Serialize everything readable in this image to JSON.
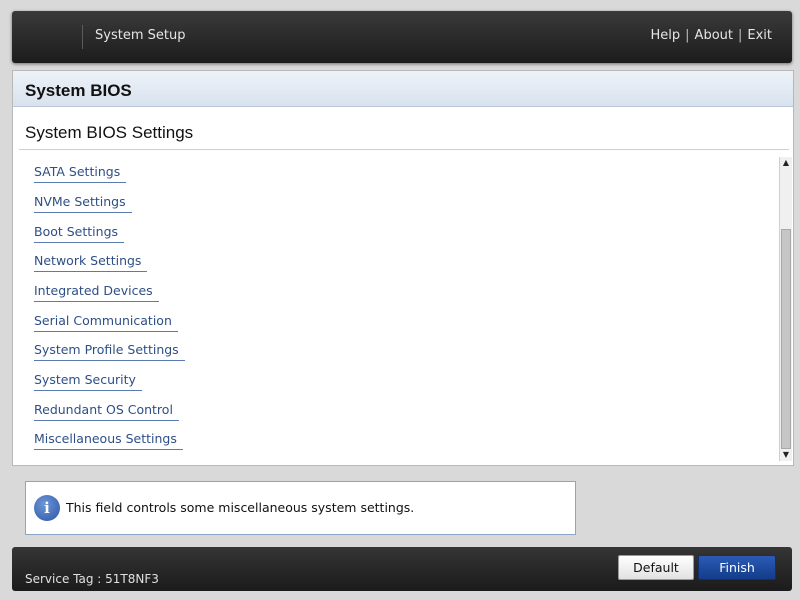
{
  "header": {
    "title": "System Setup",
    "links": [
      "Help",
      "About",
      "Exit"
    ],
    "separator": "|"
  },
  "panel": {
    "title": "System BIOS",
    "section_title": "System BIOS Settings",
    "items": [
      "SATA Settings",
      "NVMe Settings",
      "Boot Settings",
      "Network Settings",
      "Integrated Devices",
      "Serial Communication",
      "System Profile Settings",
      "System Security",
      "Redundant OS Control",
      "Miscellaneous Settings"
    ]
  },
  "scrollbar": {
    "up_glyph": "▲",
    "down_glyph": "▼"
  },
  "help": {
    "icon": "info-icon",
    "icon_glyph": "i",
    "message": "This field controls some miscellaneous system settings."
  },
  "footer": {
    "service_tag": "Service Tag : 51T8NF3",
    "default_label": "Default",
    "finish_label": "Finish"
  },
  "colors": {
    "header_bg": "#262626",
    "link_blue": "#2e4f86",
    "finish_blue": "#1f4aa0",
    "panel_header_bg": "#dde6f1"
  }
}
